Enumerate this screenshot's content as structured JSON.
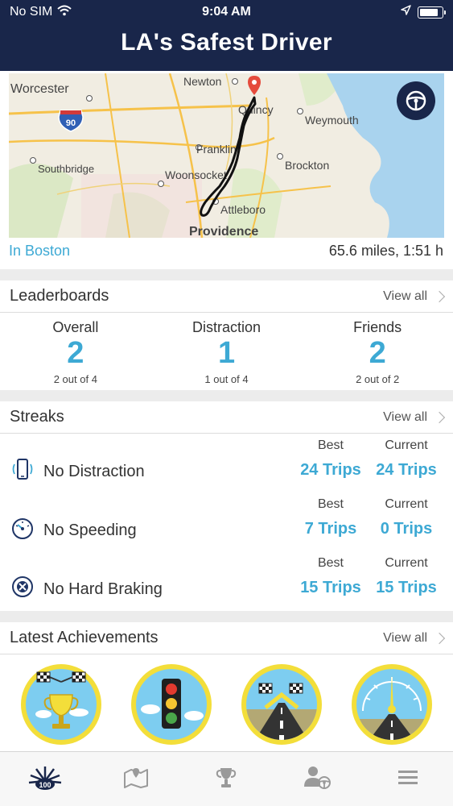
{
  "status_bar": {
    "carrier": "No SIM",
    "time": "9:04 AM",
    "battery_level": 0.85
  },
  "header": {
    "title": "LA's Safest Driver"
  },
  "trip": {
    "location": "In Boston",
    "stats": "65.6 miles, 1:51 h",
    "map_labels": {
      "worcester": "Worcester",
      "newton": "Newton",
      "quincy": "Quincy",
      "weymouth": "Weymouth",
      "franklin": "Franklin",
      "southbridge": "Southbridge",
      "woonsocket": "Woonsocket",
      "brockton": "Brockton",
      "attleboro": "Attleboro",
      "providence": "Providence",
      "i90": "90"
    }
  },
  "leaderboards": {
    "title": "Leaderboards",
    "view_all": "View all",
    "columns": [
      {
        "label": "Overall",
        "rank": "2",
        "sub": "2 out of 4"
      },
      {
        "label": "Distraction",
        "rank": "1",
        "sub": "1 out of 4"
      },
      {
        "label": "Friends",
        "rank": "2",
        "sub": "2 out of 2"
      }
    ]
  },
  "streaks": {
    "title": "Streaks",
    "view_all": "View all",
    "best_label": "Best",
    "current_label": "Current",
    "rows": [
      {
        "name": "No Distraction",
        "icon": "phone-vibrate-icon",
        "best": "24 Trips",
        "current": "24 Trips"
      },
      {
        "name": "No Speeding",
        "icon": "speedometer-icon",
        "best": "7 Trips",
        "current": "0 Trips"
      },
      {
        "name": "No Hard Braking",
        "icon": "brake-icon",
        "best": "15 Trips",
        "current": "15 Trips"
      }
    ]
  },
  "achievements": {
    "title": "Latest Achievements",
    "view_all": "View all",
    "badges": [
      "trophy-flags-badge-icon",
      "traffic-light-badge-icon",
      "road-flags-badge-icon",
      "speedometer-road-badge-icon"
    ]
  },
  "tabbar": {
    "items": [
      {
        "icon": "score-100-icon",
        "label": "100",
        "active": true
      },
      {
        "icon": "map-icon",
        "active": false
      },
      {
        "icon": "trophy-icon",
        "active": false
      },
      {
        "icon": "friends-driver-icon",
        "active": false
      },
      {
        "icon": "menu-icon",
        "active": false
      }
    ]
  },
  "colors": {
    "header_bg": "#19264a",
    "accent": "#3da9d4",
    "badge_ring": "#f3de3a",
    "badge_sky": "#7dcdf0"
  }
}
